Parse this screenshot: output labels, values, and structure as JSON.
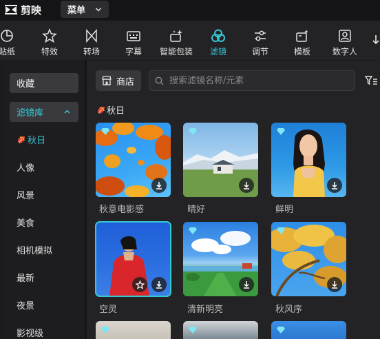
{
  "app": {
    "name": "剪映"
  },
  "titlebar": {
    "menu_label": "菜单"
  },
  "toolbar": {
    "items": [
      {
        "label": "贴纸",
        "icon": "sticker-icon",
        "active": false
      },
      {
        "label": "特效",
        "icon": "effects-star-icon",
        "active": false
      },
      {
        "label": "转场",
        "icon": "transition-bowtie-icon",
        "active": false
      },
      {
        "label": "字幕",
        "icon": "subtitle-keyboard-icon",
        "active": false
      },
      {
        "label": "智能包装",
        "icon": "smart-sparkle-box-icon",
        "active": false
      },
      {
        "label": "滤镜",
        "icon": "filter-rings-icon",
        "active": true
      },
      {
        "label": "调节",
        "icon": "adjust-sliders-icon",
        "active": false
      },
      {
        "label": "模板",
        "icon": "template-sparkle-icon",
        "active": false
      },
      {
        "label": "数字人",
        "icon": "digital-human-icon",
        "active": false
      }
    ],
    "accent": "#35c9d6"
  },
  "sidebar": {
    "favorites_label": "收藏",
    "library_label": "滤镜库",
    "items": [
      {
        "label": "秋日",
        "active": true
      },
      {
        "label": "人像",
        "active": false
      },
      {
        "label": "风景",
        "active": false
      },
      {
        "label": "美食",
        "active": false
      },
      {
        "label": "相机模拟",
        "active": false
      },
      {
        "label": "最新",
        "active": false
      },
      {
        "label": "夜景",
        "active": false
      },
      {
        "label": "影视级",
        "active": false
      }
    ]
  },
  "main": {
    "store_label": "商店",
    "search_placeholder": "搜索滤镜名称/元素",
    "section_title": "秋日",
    "filters": [
      {
        "name": "秋意电影感",
        "premium": true,
        "downloaded": false
      },
      {
        "name": "晴好",
        "premium": true,
        "downloaded": false
      },
      {
        "name": "鲜明",
        "premium": true,
        "downloaded": false
      },
      {
        "name": "空灵",
        "premium": false,
        "downloaded": false
      },
      {
        "name": "清新明亮",
        "premium": true,
        "downloaded": false
      },
      {
        "name": "秋风序",
        "premium": true,
        "downloaded": false
      }
    ]
  }
}
